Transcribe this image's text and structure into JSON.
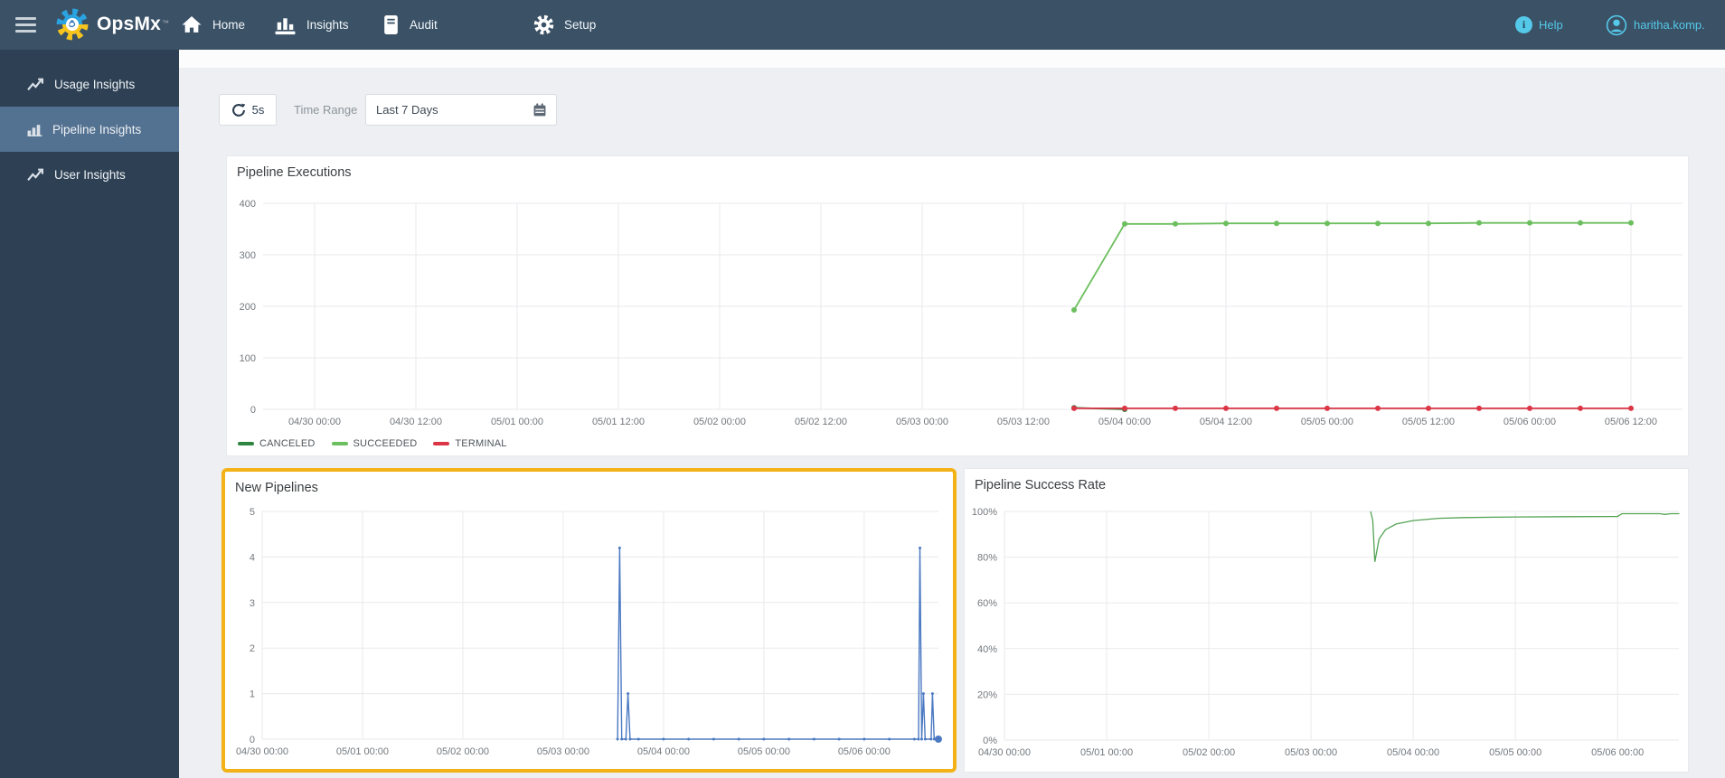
{
  "navbar": {
    "brand": "OpsMx",
    "brand_mark": "™",
    "items": [
      {
        "icon": "home-icon",
        "label": "Home"
      },
      {
        "icon": "insights-icon",
        "label": "Insights"
      },
      {
        "icon": "audit-icon",
        "label": "Audit"
      },
      {
        "icon": "setup-icon",
        "label": "Setup"
      }
    ],
    "help_label": "Help",
    "username": "haritha.komp."
  },
  "sidebar": {
    "items": [
      {
        "icon": "usage-insights-icon",
        "label": "Usage Insights",
        "active": false
      },
      {
        "icon": "pipeline-insights-icon",
        "label": "Pipeline Insights",
        "active": true
      },
      {
        "icon": "user-insights-icon",
        "label": "User Insights",
        "active": false
      }
    ]
  },
  "toolbar": {
    "refresh_interval": "5s",
    "time_range_label": "Time Range",
    "time_range_value": "Last 7 Days"
  },
  "colors": {
    "navbar_bg": "#3a5166",
    "sidebar_bg": "#2e4154",
    "sidebar_active_bg": "#537190",
    "accent_cyan": "#55c9e9",
    "highlight_border": "#f2b218",
    "page_bg": "#edeff2",
    "card_bg": "#ffffff"
  },
  "chart_data": [
    {
      "type": "line",
      "title": "Pipeline Executions",
      "ylim": [
        0,
        400
      ],
      "y_ticks": [
        {
          "v": 0,
          "label": "0"
        },
        {
          "v": 100,
          "label": "100"
        },
        {
          "v": 200,
          "label": "200"
        },
        {
          "v": 300,
          "label": "300"
        },
        {
          "v": 400,
          "label": "400"
        }
      ],
      "x_ticks": [
        "04/30 00:00",
        "04/30 12:00",
        "05/01 00:00",
        "05/01 12:00",
        "05/02 00:00",
        "05/02 12:00",
        "05/03 00:00",
        "05/03 12:00",
        "05/04 00:00",
        "05/04 12:00",
        "05/05 00:00",
        "05/05 12:00",
        "05/06 00:00",
        "05/06 12:00"
      ],
      "legend_position": "bottom-left",
      "series": [
        {
          "name": "CANCELED",
          "color": "#2e8540",
          "points": [
            [
              "05/03 18:00",
              3
            ],
            [
              "05/04 00:00",
              0
            ]
          ]
        },
        {
          "name": "SUCCEEDED",
          "color": "#6cbf5e",
          "points": [
            [
              "05/03 18:00",
              193
            ],
            [
              "05/04 00:00",
              360
            ],
            [
              "05/04 06:00",
              360
            ],
            [
              "05/04 12:00",
              361
            ],
            [
              "05/04 18:00",
              361
            ],
            [
              "05/05 00:00",
              361
            ],
            [
              "05/05 06:00",
              361
            ],
            [
              "05/05 12:00",
              361
            ],
            [
              "05/05 18:00",
              362
            ],
            [
              "05/06 00:00",
              362
            ],
            [
              "05/06 06:00",
              362
            ],
            [
              "05/06 12:00",
              362
            ]
          ]
        },
        {
          "name": "TERMINAL",
          "color": "#dc3545",
          "points": [
            [
              "05/03 18:00",
              2
            ],
            [
              "05/04 00:00",
              2
            ],
            [
              "05/04 06:00",
              2
            ],
            [
              "05/04 12:00",
              2
            ],
            [
              "05/04 18:00",
              2
            ],
            [
              "05/05 00:00",
              2
            ],
            [
              "05/05 06:00",
              2
            ],
            [
              "05/05 12:00",
              2
            ],
            [
              "05/05 18:00",
              2
            ],
            [
              "05/06 00:00",
              2
            ],
            [
              "05/06 06:00",
              2
            ],
            [
              "05/06 12:00",
              2
            ]
          ]
        }
      ]
    },
    {
      "type": "line",
      "title": "New Pipelines",
      "highlighted": true,
      "ylim": [
        0,
        5
      ],
      "y_ticks": [
        {
          "v": 0,
          "label": "0"
        },
        {
          "v": 1,
          "label": "1"
        },
        {
          "v": 2,
          "label": "2"
        },
        {
          "v": 3,
          "label": "3"
        },
        {
          "v": 4,
          "label": "4"
        },
        {
          "v": 5,
          "label": "5"
        }
      ],
      "x_ticks": [
        "04/30 00:00",
        "05/01 00:00",
        "05/02 00:00",
        "05/03 00:00",
        "05/04 00:00",
        "05/05 00:00",
        "05/06 00:00"
      ],
      "series": [
        {
          "name": "New Pipelines",
          "color": "#4b79c2",
          "points": [
            [
              "05/03 13:00",
              0
            ],
            [
              "05/03 13:30",
              4.2
            ],
            [
              "05/03 14:00",
              0
            ],
            [
              "05/03 15:00",
              0
            ],
            [
              "05/03 15:30",
              1
            ],
            [
              "05/03 16:00",
              0
            ],
            [
              "05/03 18:00",
              0
            ],
            [
              "05/04 00:00",
              0
            ],
            [
              "05/04 06:00",
              0
            ],
            [
              "05/04 12:00",
              0
            ],
            [
              "05/04 18:00",
              0
            ],
            [
              "05/05 00:00",
              0
            ],
            [
              "05/05 06:00",
              0
            ],
            [
              "05/05 12:00",
              0
            ],
            [
              "05/05 18:00",
              0
            ],
            [
              "05/06 00:00",
              0
            ],
            [
              "05/06 06:00",
              0
            ],
            [
              "05/06 12:00",
              0
            ],
            [
              "05/06 13:00",
              0
            ],
            [
              "05/06 13:20",
              4.2
            ],
            [
              "05/06 13:45",
              0
            ],
            [
              "05/06 14:10",
              1
            ],
            [
              "05/06 14:35",
              0
            ],
            [
              "05/06 16:00",
              0
            ],
            [
              "05/06 16:20",
              1
            ],
            [
              "05/06 16:45",
              0
            ],
            [
              "05/06 17:45",
              0
            ]
          ]
        }
      ]
    },
    {
      "type": "line",
      "title": "Pipeline Success Rate",
      "ylim": [
        0,
        100
      ],
      "y_ticks": [
        {
          "v": 0,
          "label": "0%"
        },
        {
          "v": 20,
          "label": "20%"
        },
        {
          "v": 40,
          "label": "40%"
        },
        {
          "v": 60,
          "label": "60%"
        },
        {
          "v": 80,
          "label": "80%"
        },
        {
          "v": 100,
          "label": "100%"
        }
      ],
      "x_ticks": [
        "04/30 00:00",
        "05/01 00:00",
        "05/02 00:00",
        "05/03 00:00",
        "05/04 00:00",
        "05/05 00:00",
        "05/06 00:00"
      ],
      "series": [
        {
          "name": "Success Rate",
          "color": "#53a353",
          "points": [
            [
              "05/03 14:00",
              100
            ],
            [
              "05/03 14:30",
              96
            ],
            [
              "05/03 15:00",
              78
            ],
            [
              "05/03 16:00",
              88
            ],
            [
              "05/03 17:30",
              92
            ],
            [
              "05/03 20:00",
              94.5
            ],
            [
              "05/04 00:00",
              96
            ],
            [
              "05/04 06:00",
              97
            ],
            [
              "05/04 12:00",
              97.3
            ],
            [
              "05/05 00:00",
              97.6
            ],
            [
              "05/05 12:00",
              97.7
            ],
            [
              "05/06 00:00",
              97.8
            ],
            [
              "05/06 01:00",
              99
            ],
            [
              "05/06 10:00",
              99
            ],
            [
              "05/06 11:00",
              98.7
            ],
            [
              "05/06 12:30",
              99
            ],
            [
              "05/06 14:30",
              99
            ]
          ]
        }
      ]
    }
  ]
}
